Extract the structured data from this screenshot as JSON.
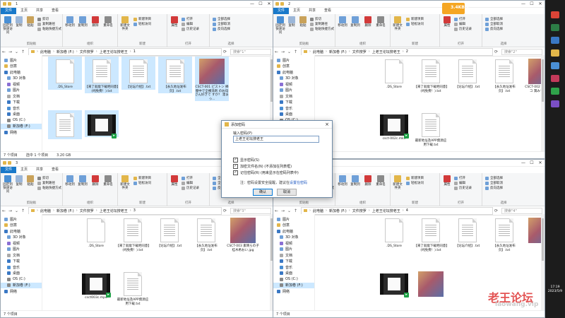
{
  "colors": {
    "accent": "#1979ca",
    "selection": "#cce8ff",
    "folder": "#e2b64a",
    "badge": "#1da146"
  },
  "ribbon": {
    "tabs": [
      "文件",
      "主页",
      "共享",
      "查看"
    ],
    "clipboard": {
      "pin": "固定到快速访问",
      "copy": "复制",
      "paste": "粘贴",
      "copy_path": "复制路径",
      "paste_shortcut": "粘贴快捷方式",
      "cut": "剪切",
      "label": "剪贴板"
    },
    "organize": {
      "move_to": "移动到",
      "copy_to": "复制到",
      "delete": "删除",
      "rename": "重命名",
      "label": "组织"
    },
    "new": {
      "new_folder": "新建文件夹",
      "new_item": "新建项目",
      "easy_access": "轻松访问",
      "label": "新建"
    },
    "open": {
      "properties": "属性",
      "open": "打开",
      "edit": "编辑",
      "history": "历史记录",
      "label": "打开"
    },
    "select": {
      "select_all": "全部选择",
      "select_none": "全部取消",
      "invert": "反向选择",
      "label": "选择"
    }
  },
  "nav": {
    "items": [
      {
        "label": "图片"
      },
      {
        "label": "创意"
      },
      {
        "label": "此电脑"
      },
      {
        "label": "3D 对象"
      },
      {
        "label": "视频"
      },
      {
        "label": "图片"
      },
      {
        "label": "文档"
      },
      {
        "label": "下载"
      },
      {
        "label": "音乐"
      },
      {
        "label": "桌面"
      },
      {
        "label": "OS (C:)"
      },
      {
        "label": "新加卷 (F:)"
      },
      {
        "label": "网络"
      }
    ]
  },
  "windows": [
    {
      "path": [
        "此电脑",
        "新加卷 (F:)",
        "文件搜罗",
        "上老王论坛搜老王",
        "1"
      ],
      "search_placeholder": "搜索\"1\"",
      "files": [
        {
          "name": ".DS_Store",
          "kind": "doc"
        },
        {
          "name": "【来了就能下载吧同意】(纯免费！).txt",
          "kind": "doc-lines"
        },
        {
          "name": "【论坛介绍】.txt",
          "kind": "doc-lines"
        },
        {
          "name": "【永久地址发布页】.txt",
          "kind": "doc-lines"
        },
        {
          "name": "CSCT-001 ピストン 挿膣中で全裸洗剤 のお母さん好きで すか？ 溜まっ...",
          "kind": "thumb"
        },
        {
          "name": "",
          "kind": "doc-lines"
        },
        {
          "name": "",
          "kind": "video"
        }
      ],
      "status": {
        "count": "7 个项目",
        "selected": "选中 1 个项目",
        "size": "3.20 GB"
      }
    },
    {
      "path": [
        "此电脑",
        "新加卷 (F:)",
        "文件搜罗",
        "上老王论坛搜老王",
        "2"
      ],
      "search_placeholder": "搜索\"2\"",
      "files": [
        {
          "name": ".DS_Store",
          "kind": "doc"
        },
        {
          "name": "【来了就能下载吧同意】(纯免费！).txt",
          "kind": "doc-lines"
        },
        {
          "name": "【论坛介绍】.txt",
          "kind": "doc-lines"
        },
        {
          "name": "【永久地址发布页】.txt",
          "kind": "doc-lines"
        },
        {
          "name": "CSCT-002 東出のオナコ 潤みつき.jpg",
          "kind": "thumb"
        },
        {
          "name": "csct-002c.mkv",
          "kind": "video"
        },
        {
          "name": "最新地址及APP資源应用下载.txt",
          "kind": "doc-lines"
        }
      ],
      "status": {
        "count": "7 个项目",
        "selected": "",
        "size": ""
      }
    },
    {
      "path": [
        "此电脑",
        "新加卷 (F:)",
        "文件搜罗",
        "上老王论坛搜老王",
        "3"
      ],
      "search_placeholder": "搜索\"3\"",
      "files": [
        {
          "name": ".DS_Store",
          "kind": "doc"
        },
        {
          "name": "【来了就能下载吧同意】(纯免费！).txt",
          "kind": "doc-lines"
        },
        {
          "name": "【论坛介绍】.txt",
          "kind": "doc-lines"
        },
        {
          "name": "【永久地址发布页】.txt",
          "kind": "doc-lines"
        },
        {
          "name": "CSCT-003 素晴らの子 桂木希おい.jpg",
          "kind": "thumb"
        },
        {
          "name": "csct003c.mp4",
          "kind": "video"
        },
        {
          "name": "最新地址及APP資源应用下载.txt",
          "kind": "doc-lines"
        }
      ],
      "status": {
        "count": "7 个项目",
        "selected": "",
        "size": ""
      }
    },
    {
      "path": [
        "此电脑",
        "新加卷 (F:)",
        "文件搜罗",
        "上老王论坛搜老王",
        "4"
      ],
      "search_placeholder": "搜索\"4\"",
      "files": [
        {
          "name": ".DS_Store",
          "kind": "doc"
        },
        {
          "name": "【来了就能下载吧同意】(纯免费！).txt",
          "kind": "doc-lines"
        },
        {
          "name": "【论坛介绍】.txt",
          "kind": "doc-lines"
        },
        {
          "name": "【永久地址发布页】.txt",
          "kind": "doc-lines"
        },
        {
          "name": "",
          "kind": "thumb"
        },
        {
          "name": "",
          "kind": "video"
        },
        {
          "name": "",
          "kind": "thumb"
        }
      ],
      "status": {
        "count": "7 个项目",
        "selected": "",
        "size": ""
      }
    }
  ],
  "dialog": {
    "title": "添加密码",
    "label": "输入密码(P)",
    "value": "上老王论坛搜老王",
    "options": [
      "显示密码(S)",
      "加密文件名(N) (不添加在列表框)",
      "记住密码(R) (用来显示在密码列表中)"
    ],
    "note_prefix": "注：密码设置安全提醒，建议在",
    "note_link": "设置在密码",
    "ok": "确认",
    "cancel": "取消"
  },
  "watermark": {
    "line1": "老王论坛",
    "line2": "laowang.vip"
  },
  "speed_badge": "3.4KB/s",
  "clock": {
    "time": "17:19",
    "date": "2023/5/9"
  }
}
